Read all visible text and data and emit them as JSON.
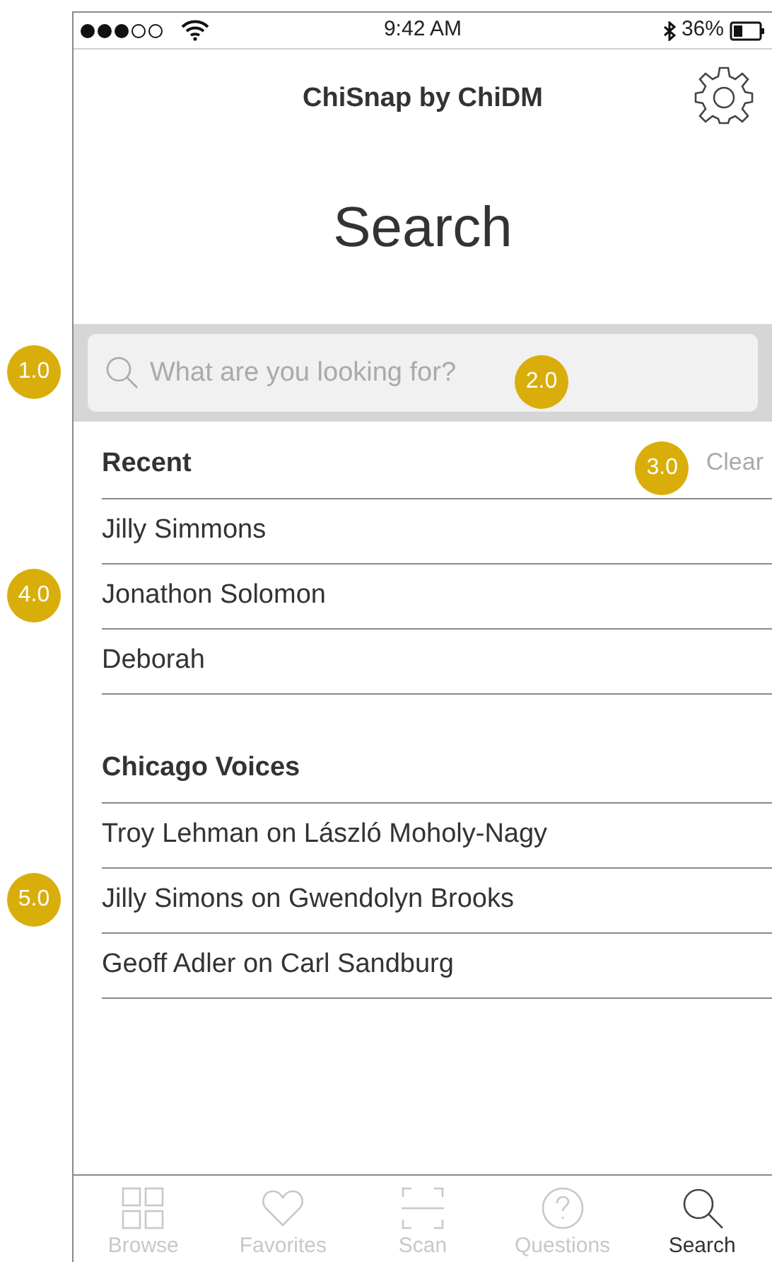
{
  "status_bar": {
    "time": "9:42 AM",
    "battery": "36%"
  },
  "header": {
    "title": "ChiSnap by ChiDM"
  },
  "page_title": "Search",
  "search": {
    "placeholder": "What are you looking for?",
    "badge": "2.0",
    "band_badge": "1.0"
  },
  "recent": {
    "heading": "Recent",
    "clear": "Clear",
    "clear_badge": "3.0",
    "items": [
      {
        "label": "Jilly Simmons"
      },
      {
        "label": "Jonathon Solomon",
        "badge": "4.0"
      },
      {
        "label": "Deborah"
      }
    ]
  },
  "chicago_voices": {
    "heading": "Chicago Voices",
    "items": [
      {
        "label": "Troy Lehman on László Moholy-Nagy"
      },
      {
        "label": "Jilly Simons on Gwendolyn Brooks",
        "badge": "5.0"
      },
      {
        "label": "Geoff Adler on Carl Sandburg"
      }
    ]
  },
  "tab_bar": {
    "tabs": [
      {
        "label": "Browse",
        "kind": "grid",
        "selected": false
      },
      {
        "label": "Favorites",
        "kind": "heart",
        "selected": false
      },
      {
        "label": "Scan",
        "kind": "scan",
        "selected": false
      },
      {
        "label": "Questions",
        "kind": "question",
        "selected": false
      },
      {
        "label": "Search",
        "kind": "search",
        "selected": true
      }
    ]
  }
}
